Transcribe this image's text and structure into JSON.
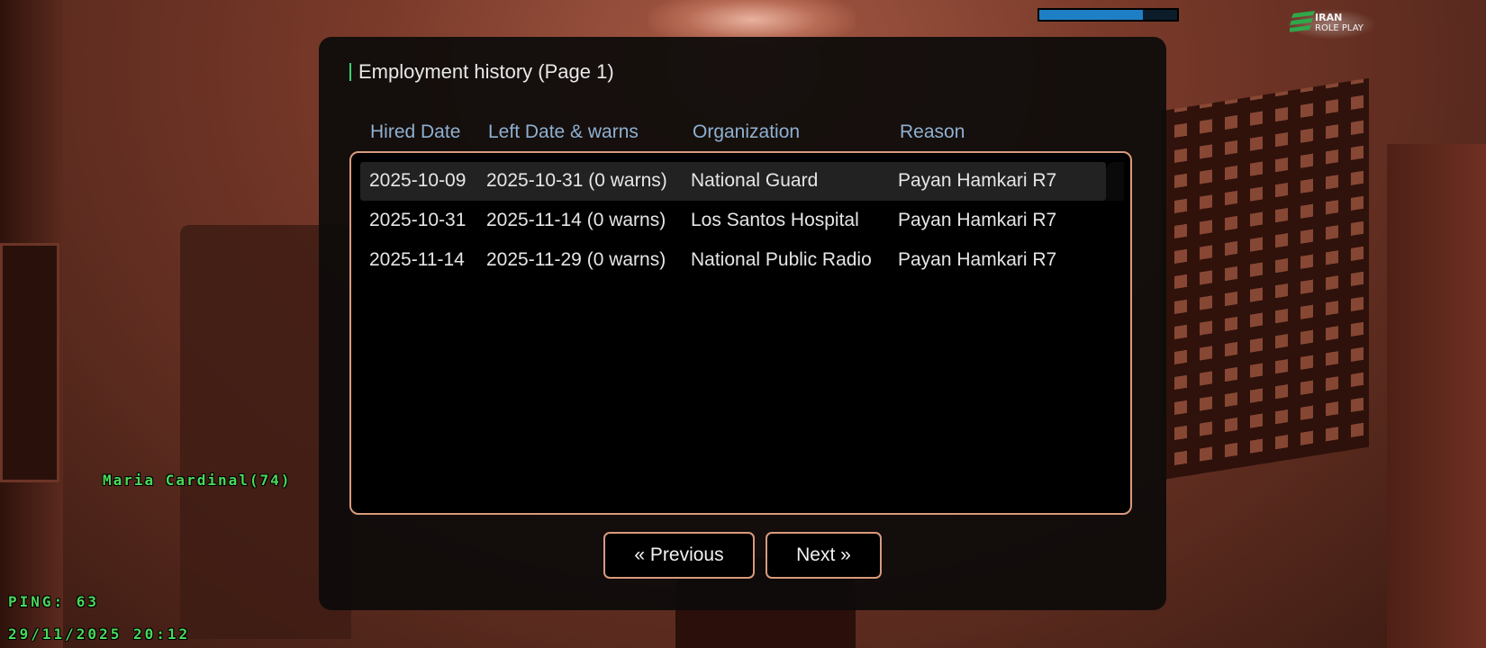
{
  "dialog": {
    "title": "Employment history (Page 1)",
    "columns": [
      "Hired Date",
      "Left Date & warns",
      "Organization",
      "Reason"
    ],
    "rows": [
      {
        "hired": "2025-10-09",
        "left": "2025-10-31 (0 warns)",
        "organization": "National Guard",
        "reason": "Payan Hamkari R7"
      },
      {
        "hired": "2025-10-31",
        "left": "2025-11-14 (0 warns)",
        "organization": "Los Santos Hospital",
        "reason": "Payan Hamkari R7"
      },
      {
        "hired": "2025-11-14",
        "left": "2025-11-29 (0 warns)",
        "organization": "National Public Radio",
        "reason": "Payan Hamkari R7"
      }
    ],
    "selected_row": 0,
    "buttons": {
      "previous": "« Previous",
      "next": "Next »"
    }
  },
  "hud": {
    "player_name": "Maria Cardinal(74)",
    "ping": "PING: 63",
    "datetime": "29/11/2025 20:12",
    "status_bar_level": 0.75,
    "logo": {
      "line1": "IRAN",
      "line2": "ROLE PLAY"
    }
  },
  "colors": {
    "accent_green": "#3bd36c",
    "header_blue": "#8fb0d1",
    "border_peach": "#d99a7c",
    "hud_green": "#49d95a",
    "bar_blue": "#1f7fc4"
  }
}
